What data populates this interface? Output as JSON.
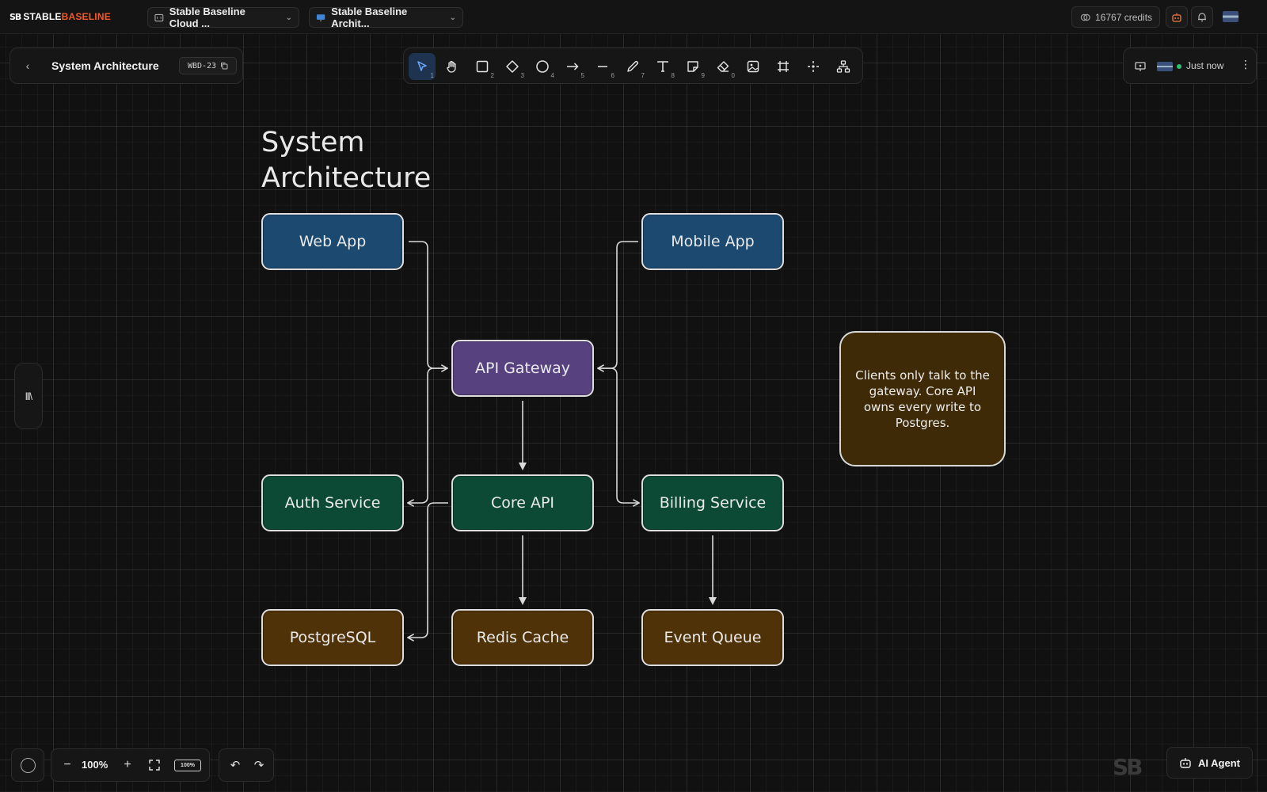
{
  "topbar": {
    "logo_mark": "SB",
    "logo_word1": "STABLE",
    "logo_word2": "BASELINE",
    "workspace_label": "Stable Baseline Cloud ...",
    "document_label": "Stable Baseline Archit...",
    "credits_label": "16767 credits"
  },
  "title_panel": {
    "title": "System Architecture",
    "doc_id": "WBD-23"
  },
  "toolbar": {
    "tools": [
      {
        "name": "select",
        "key": "1"
      },
      {
        "name": "hand",
        "key": ""
      },
      {
        "name": "rectangle",
        "key": "2"
      },
      {
        "name": "diamond",
        "key": "3"
      },
      {
        "name": "ellipse",
        "key": "4"
      },
      {
        "name": "arrow",
        "key": "5"
      },
      {
        "name": "line",
        "key": "6"
      },
      {
        "name": "draw",
        "key": "7"
      },
      {
        "name": "text",
        "key": "8"
      },
      {
        "name": "sticky-note",
        "key": "9"
      },
      {
        "name": "eraser",
        "key": "0"
      },
      {
        "name": "image",
        "key": ""
      },
      {
        "name": "frame",
        "key": ""
      },
      {
        "name": "laser",
        "key": ""
      },
      {
        "name": "diagram",
        "key": ""
      }
    ]
  },
  "right_panel": {
    "status": "Just now"
  },
  "library": {
    "label": "lll\\"
  },
  "canvas": {
    "title": "System Architecture",
    "nodes": {
      "web_app": "Web App",
      "mobile_app": "Mobile App",
      "api_gateway": "API Gateway",
      "auth_service": "Auth Service",
      "core_api": "Core API",
      "billing_service": "Billing Service",
      "postgresql": "PostgreSQL",
      "redis_cache": "Redis Cache",
      "event_queue": "Event Queue"
    },
    "note": "Clients only talk to the gateway. Core API owns every write to Postgres.",
    "colors": {
      "client": "#1b4970",
      "gateway": "#57427f",
      "service": "#0c4a35",
      "storage": "#4f3208",
      "note": "#3e2a06",
      "edge": "#d9d9d9"
    }
  },
  "bottom": {
    "zoom_minus": "−",
    "zoom_value": "100%",
    "zoom_plus": "+",
    "zoom_badge": "100%",
    "undo": "↶",
    "redo": "↷",
    "watermark": "SB",
    "ai_agent_label": "AI Agent"
  }
}
